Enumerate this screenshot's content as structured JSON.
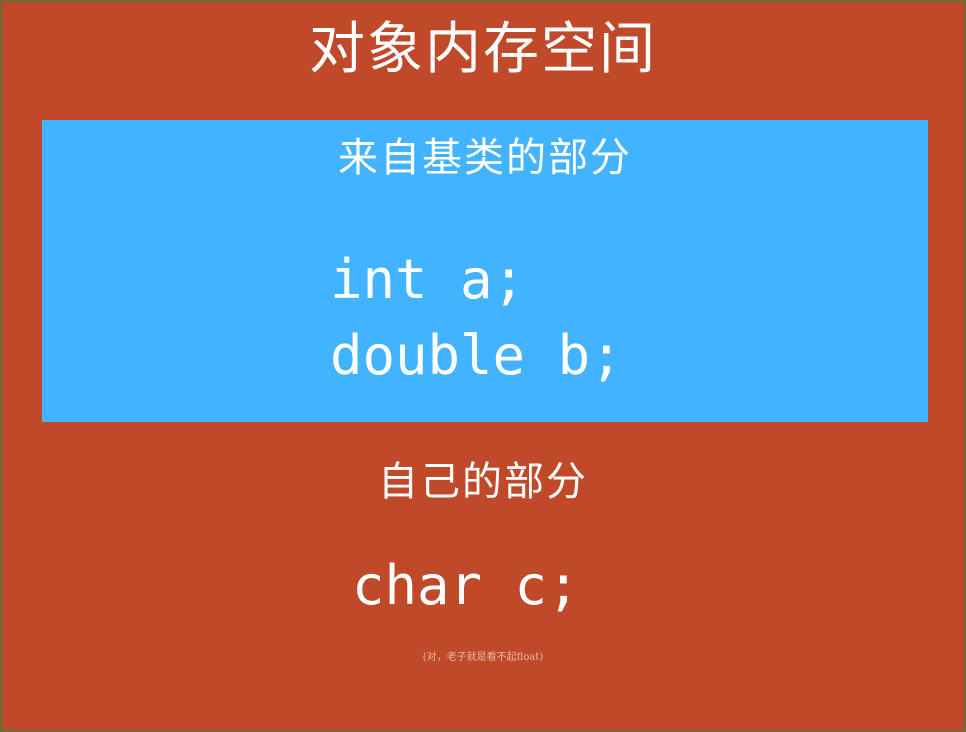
{
  "title": "对象内存空间",
  "base_section": {
    "label": "来自基类的部分",
    "code_lines": [
      "int a;",
      "double b;"
    ]
  },
  "own_section": {
    "label": "自己的部分",
    "code_lines": [
      "char c;"
    ]
  },
  "note": "(对，老子就是看不起float)",
  "colors": {
    "background": "#c0492a",
    "base_box": "#41b3ff",
    "text": "#ffffff",
    "border": "#6b6b3a"
  }
}
